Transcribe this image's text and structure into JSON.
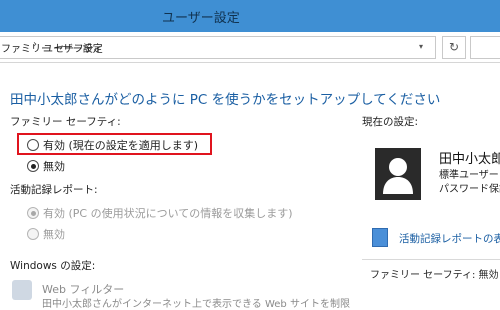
{
  "window": {
    "title": "ユーザー設定"
  },
  "address": {
    "crumbs": [
      "ファミリー セーフティ",
      "ユーザー設定"
    ]
  },
  "heading": "田中小太郎さんがどのように PC を使うかをセットアップしてください",
  "family_safety": {
    "label": "ファミリー セーフティ:",
    "options": [
      {
        "label": "有効 (現在の設定を適用します)",
        "checked": false
      },
      {
        "label": "無効",
        "checked": true
      }
    ]
  },
  "activity_report": {
    "label": "活動記録レポート:",
    "options": [
      {
        "label": "有効 (PC の使用状況についての情報を収集します)",
        "checked": true,
        "disabled": true
      },
      {
        "label": "無効",
        "checked": false,
        "disabled": true
      }
    ]
  },
  "windows_settings": {
    "label": "Windows の設定:",
    "web_filter": "Web フィルター",
    "web_filter_desc": "田中小太郎さんがインターネット上で表示できる Web サイトを制限"
  },
  "current_settings": {
    "label": "現在の設定:",
    "user_name": "田中小太郎",
    "account_type": "標準ユーザー",
    "password_status": "パスワード保護",
    "report_link": "活動記録レポートの表示",
    "family_safety_row": "ファミリー セーフティ:  無効"
  },
  "colors": {
    "titlebar": "#3f8fd3",
    "heading": "#1b5fa3",
    "highlight": "#e0141e"
  }
}
